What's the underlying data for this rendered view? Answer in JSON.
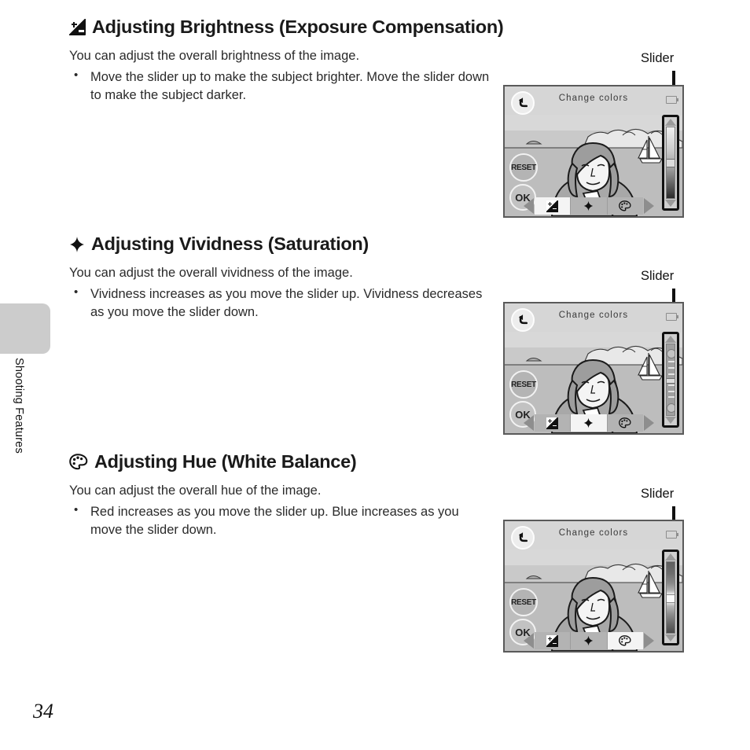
{
  "page": {
    "number": "34",
    "side_tab_label": "Shooting Features"
  },
  "sections": [
    {
      "icon": "exposure-compensation-icon",
      "heading": "Adjusting Brightness (Exposure Compensation)",
      "intro": "You can adjust the overall brightness of the image.",
      "bullets": [
        "Move the slider up to make the subject brighter. Move the slider down to make the subject darker."
      ],
      "callout": "Slider"
    },
    {
      "icon": "vividness-diamond-icon",
      "heading": "Adjusting Vividness (Saturation)",
      "intro": "You can adjust the overall vividness of the image.",
      "bullets": [
        "Vividness increases as you move the slider up. Vividness decreases as you move the slider down."
      ],
      "callout": "Slider"
    },
    {
      "icon": "hue-palette-icon",
      "heading": "Adjusting Hue (White Balance)",
      "intro": "You can adjust the overall hue of the image.",
      "bullets": [
        "Red increases as you move the slider up. Blue increases as you move the slider down."
      ],
      "callout": "Slider"
    }
  ],
  "camera_screen": {
    "title": "Change colors",
    "back_button": "back-arrow",
    "reset_button": "RESET",
    "ok_button": "OK",
    "battery_indicator": "battery-icon",
    "toolbar": {
      "left_arrow": "scroll-left",
      "right_arrow": "scroll-right",
      "items": [
        {
          "name": "brightness",
          "icon": "exposure-compensation-icon"
        },
        {
          "name": "vividness",
          "icon": "diamond-icon"
        },
        {
          "name": "hue",
          "icon": "palette-icon"
        }
      ]
    },
    "screens": [
      {
        "active_tool": "brightness",
        "slider_type": "brightness",
        "handle_percent": 48
      },
      {
        "active_tool": "vividness",
        "slider_type": "vividness",
        "handle_percent": 45
      },
      {
        "active_tool": "hue",
        "slider_type": "hue",
        "handle_percent": 50
      }
    ]
  },
  "colors": {
    "side_tab": "#cccccc",
    "screen_bezel": "#5a5a5a",
    "screen_background": "#d2d2d2",
    "slider_border": "#111111",
    "active_tool_background": "#f4f4f4",
    "text": "#2a2a2a"
  }
}
